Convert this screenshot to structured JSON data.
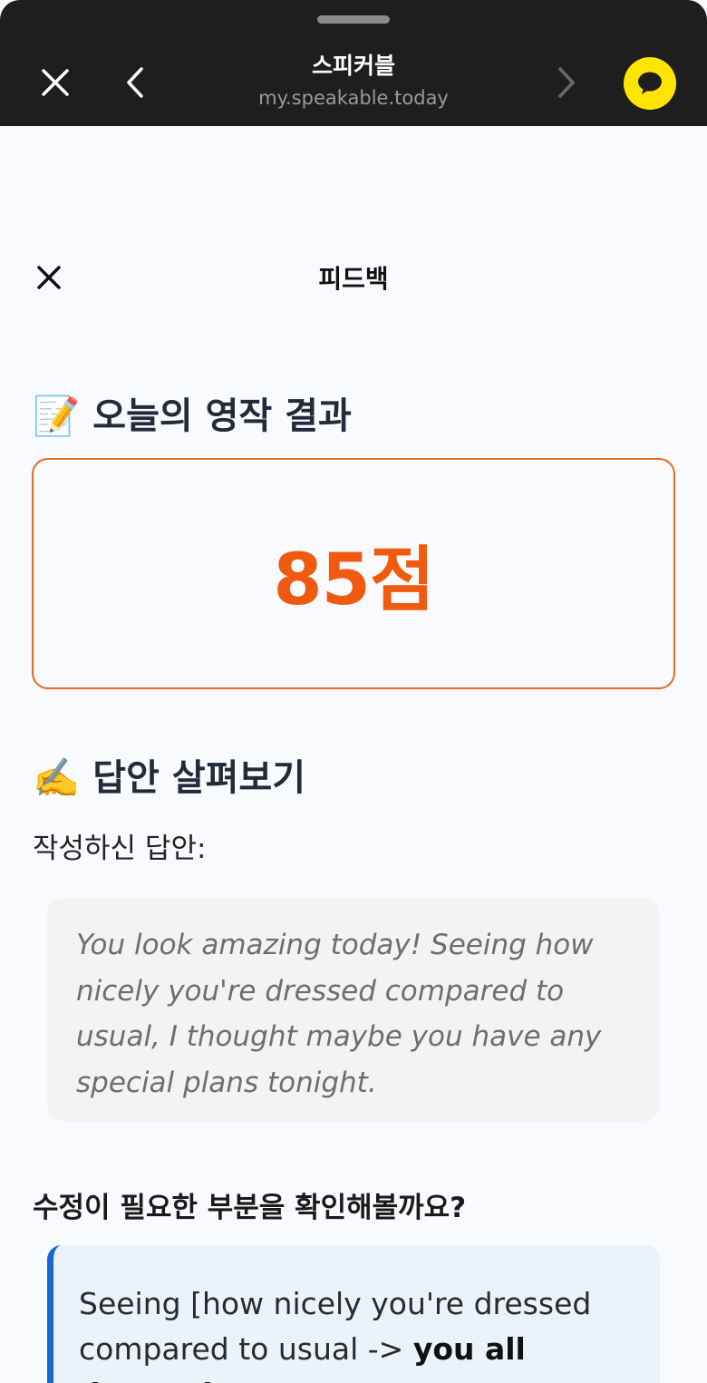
{
  "browser": {
    "title": "스피커블",
    "url": "my.speakable.today"
  },
  "header": {
    "title": "피드백"
  },
  "result": {
    "emoji": "📝",
    "title": "오늘의 영작 결과",
    "score": "85점",
    "accent_color": "#f05a0e"
  },
  "review": {
    "emoji": "✍️",
    "title": "답안 살펴보기",
    "written_label": "작성하신 답안:",
    "answer": "You look amazing today! Seeing how nicely you're dressed compared to usual, I thought maybe you have any special plans tonight."
  },
  "correction": {
    "title": "수정이 필요한 부분을 확인해볼까요?",
    "text_before": "Seeing [how nicely you're dressed compared to usual -> ",
    "text_bold": "you all dressed",
    "accent_color": "#1867d2"
  }
}
